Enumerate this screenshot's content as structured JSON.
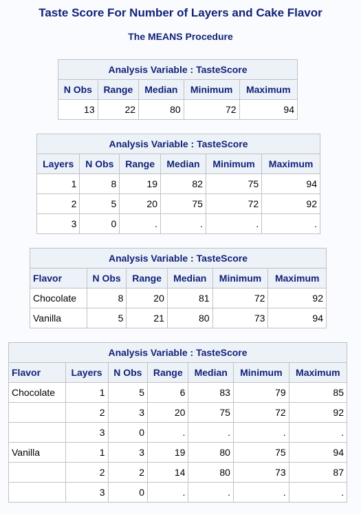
{
  "title": "Taste Score For Number of Layers and Cake Flavor",
  "procedure": "The MEANS Procedure",
  "colors": {
    "header_text": "#112277",
    "header_bg": "#edf2f9",
    "border": "#c1c1c1",
    "page_bg": "#fafbfe"
  },
  "tables": [
    {
      "caption": "Analysis Variable : TasteScore",
      "columns": [
        "N Obs",
        "Range",
        "Median",
        "Minimum",
        "Maximum"
      ],
      "rows": [
        [
          "13",
          "22",
          "80",
          "72",
          "94"
        ]
      ]
    },
    {
      "caption": "Analysis Variable : TasteScore",
      "columns": [
        "Layers",
        "N Obs",
        "Range",
        "Median",
        "Minimum",
        "Maximum"
      ],
      "rows": [
        [
          "1",
          "8",
          "19",
          "82",
          "75",
          "94"
        ],
        [
          "2",
          "5",
          "20",
          "75",
          "72",
          "92"
        ],
        [
          "3",
          "0",
          ".",
          ".",
          ".",
          "."
        ]
      ]
    },
    {
      "caption": "Analysis Variable : TasteScore",
      "columns": [
        "Flavor",
        "N Obs",
        "Range",
        "Median",
        "Minimum",
        "Maximum"
      ],
      "rows": [
        [
          "Chocolate",
          "8",
          "20",
          "81",
          "72",
          "92"
        ],
        [
          "Vanilla",
          "5",
          "21",
          "80",
          "73",
          "94"
        ]
      ]
    },
    {
      "caption": "Analysis Variable : TasteScore",
      "columns": [
        "Flavor",
        "Layers",
        "N Obs",
        "Range",
        "Median",
        "Minimum",
        "Maximum"
      ],
      "rows": [
        [
          "Chocolate",
          "1",
          "5",
          "6",
          "83",
          "79",
          "85"
        ],
        [
          "",
          "2",
          "3",
          "20",
          "75",
          "72",
          "92"
        ],
        [
          "",
          "3",
          "0",
          ".",
          ".",
          ".",
          "."
        ],
        [
          "Vanilla",
          "1",
          "3",
          "19",
          "80",
          "75",
          "94"
        ],
        [
          "",
          "2",
          "2",
          "14",
          "80",
          "73",
          "87"
        ],
        [
          "",
          "3",
          "0",
          ".",
          ".",
          ".",
          "."
        ]
      ]
    }
  ]
}
